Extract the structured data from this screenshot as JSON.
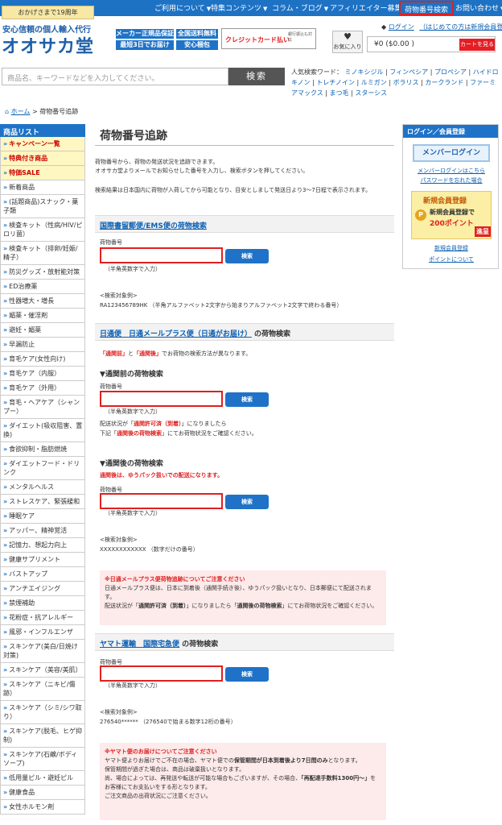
{
  "header": {
    "anniversary": "おかげさまで19周年",
    "tagline": "安心信頼の個人輸入代行",
    "logo": "オオサカ堂",
    "nav": [
      "ご利用について",
      "特集コンテンツ",
      "コラム・ブログ",
      "アフィリエイター募集",
      "荷物番号検索",
      "お問い合わせ"
    ],
    "badges": [
      "メーカー正規品保証",
      "全国送料無料",
      "最短3日でお届け",
      "安心梱包"
    ],
    "credit_card": "クレジットカード払い",
    "credit_card_note": "銀行振込も対応",
    "favorites": "お気に入り",
    "login": "ログイン",
    "first_time": "（はじめての方は新規会員登録）",
    "cart_amount": "¥0 ($0.00 )",
    "cart_button": "カートを見る"
  },
  "search": {
    "placeholder": "商品名、キーワードなどを入力してください。",
    "button": "検索",
    "popular_label": "人気検索ワード：",
    "popular": [
      "ミノキシジル",
      "フィンペシア",
      "プロペシア",
      "ハイドロキノン",
      "トレチノイン",
      "ルミガン",
      "ボラリス",
      "カークランド",
      "ファーミアマックス",
      "まつ毛",
      "スターシス"
    ]
  },
  "breadcrumb": {
    "home": "ホーム",
    "current": "荷物番号追跡"
  },
  "sidebar": {
    "title": "商品リスト",
    "items": [
      "キャンペーン一覧",
      "特典付き商品",
      "特価SALE",
      "新着商品",
      "(話題商品)スナック・菓子類",
      "検査キット（性病/HIV/ピロリ菌）",
      "検査キット（排卵/妊娠/精子）",
      "防災グッズ・放射能対策",
      "ED治療薬",
      "性器増大・増長",
      "媚薬・催淫剤",
      "避妊・媚薬",
      "早漏防止",
      "育毛ケア(女性向け)",
      "育毛ケア（内服）",
      "育毛ケア（外用）",
      "育毛・ヘアケア（シャンプー）",
      "ダイエット(吸収阻害、置換)",
      "食欲抑制・脂肪燃焼",
      "ダイエットフード・ドリンク",
      "メンタルヘルス",
      "ストレスケア、緊張緩和",
      "睡眠ケア",
      "アッパー、精神覚活",
      "記憶力、想起力向上",
      "健康サプリメント",
      "バストアップ",
      "アンチエイジング",
      "禁煙補助",
      "花粉症・抗アレルギー",
      "風邪・インフルエンザ",
      "スキンケア(美白/日焼け対策)",
      "スキンケア（美容/美肌）",
      "スキンケア（ニキビ/傷跡）",
      "スキンケア（シミ/シワ取り）",
      "スキンケア(脱毛、ヒゲ抑制)",
      "スキンケア(石鹸/ボディソープ)",
      "低用量ピル・避妊ピル",
      "健康食品",
      "女性ホルモン剤"
    ]
  },
  "main": {
    "title": "荷物番号追跡",
    "intro1": "荷物番号から、荷物の発送状況を追跡できます。",
    "intro2": "オオサカ堂よりメールでお知らせした番号を入力し、検索ボタンを押してください。",
    "intro3": "検索結果は日本国内に荷物が入荷してから可能となり、目安としまして発送日より3〜7日程で表示されます。",
    "ems_title": "国際書留郵便/EMS便の荷物検索",
    "label": "荷物番号",
    "button": "検索",
    "hint": "（半角英数字で入力）",
    "example_label": "<検索対象例>",
    "ems_example": "RA123456789HK （半角アルファベット2文字から始まりアルファベット2文字で終わる番号）",
    "nippon_title_a": "日通便　日通メールプラス便（日通がお届け）",
    "nippon_title_b": "の荷物検索",
    "nippon_note_a": "「通関前」",
    "nippon_note_b": "と",
    "nippon_note_c": "「通関後」",
    "nippon_note_d": "でお荷物の検索方法が異なります。",
    "before_title": "▼通関前の荷物検索",
    "before_note1a": "配送状況が「",
    "before_note1b": "通関許可済（到着）",
    "before_note1c": "」になりましたら",
    "before_note2a": "下記「",
    "before_note2b": "通関後の荷物検索",
    "before_note2c": "」にてお荷物状況をご確認ください。",
    "after_title": "▼通関後の荷物検索",
    "after_red": "通関後は、ゆうパック扱いでの配送になります。",
    "after_example": "XXXXXXXXXXXX （数字だけの番号）",
    "nippon_warn_title": "※日通メールプラス便荷物追跡についてご注意ください",
    "nippon_warn_1": "日通メールプラス便は、日本に到着後（通関手続き後）、ゆうパック扱いとなり、日本郵便にて配送されます。",
    "nippon_warn_2a": "配送状況が「",
    "nippon_warn_2b": "通関許可済（到着）",
    "nippon_warn_2c": "」になりましたら「",
    "nippon_warn_2d": "通関後の荷物検索",
    "nippon_warn_2e": "」にてお荷物状況をご確認ください。",
    "yamato_title_a": "ヤマト運輸　国際宅急便",
    "yamato_title_b": "の荷物検索",
    "yamato_example": "276540****** （276540で始まる数字12桁の番号）",
    "yamato_warn_title": "※ヤマト便のお届けについてご注意ください",
    "yamato_warn_1a": "ヤマト便よりお届けでご不在の場合、ヤマト便での",
    "yamato_warn_1b": "保管期間が日本到着後より7日間のみ",
    "yamato_warn_1c": "となります。",
    "yamato_warn_2": "保管期間が過ぎた場合は、商品は破棄扱いとなります。",
    "yamato_warn_3a": "尚、場合によっては、再発送や転送が可能な場合もございますが、その場合、",
    "yamato_warn_3b": "「再配達手数料1300円〜」",
    "yamato_warn_3c": "をお客様にてお支払いをする形となります。",
    "yamato_warn_4": "ご注文商品の出荷状況にご注意ください。"
  },
  "right": {
    "title": "ログイン／会員登録",
    "member_login": "メンバーログイン",
    "login_here": "メンバーログインはこちら",
    "forgot": "パスワードを忘れた場合",
    "reg_title": "新規会員登録",
    "reg_text": "新規会員登録で",
    "reg_points": "200ポイント",
    "reg_gift": "進呈",
    "reg_link": "新規会員登録",
    "points_link": "ポイントについて"
  }
}
